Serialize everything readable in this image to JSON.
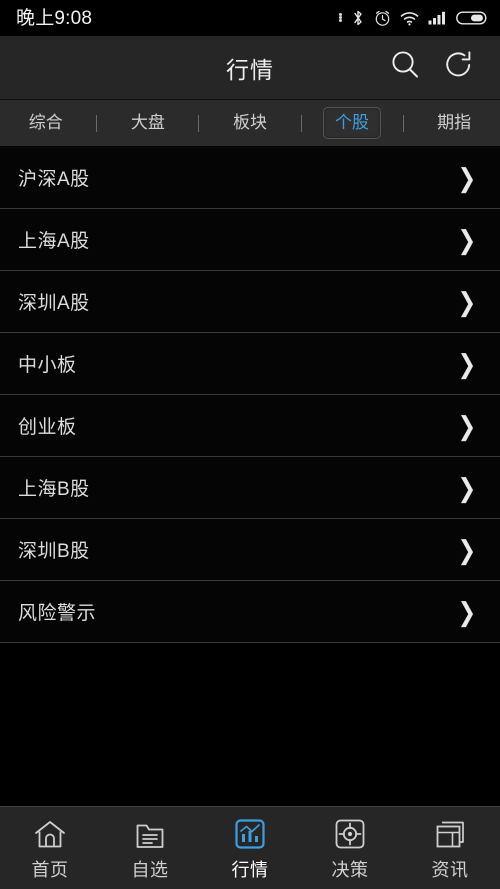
{
  "statusbar": {
    "time": "晚上9:08",
    "icons": [
      "more-dots",
      "bluetooth-icon",
      "alarm-icon",
      "wifi-icon",
      "signal-icon",
      "battery-icon"
    ]
  },
  "header": {
    "title": "行情",
    "search_label": "search-icon",
    "refresh_label": "refresh-icon"
  },
  "tabs": {
    "items": [
      {
        "label": "综合",
        "active": false
      },
      {
        "label": "大盘",
        "active": false
      },
      {
        "label": "板块",
        "active": false
      },
      {
        "label": "个股",
        "active": true
      },
      {
        "label": "期指",
        "active": false
      }
    ],
    "active_color": "#3d9ee0"
  },
  "list": {
    "chevron": "›",
    "items": [
      {
        "label": "沪深A股"
      },
      {
        "label": "上海A股"
      },
      {
        "label": "深圳A股"
      },
      {
        "label": "中小板"
      },
      {
        "label": "创业板"
      },
      {
        "label": "上海B股"
      },
      {
        "label": "深圳B股"
      },
      {
        "label": "风险警示"
      }
    ]
  },
  "bottomnav": {
    "items": [
      {
        "label": "首页",
        "icon": "home-icon",
        "active": false
      },
      {
        "label": "自选",
        "icon": "watchlist-icon",
        "active": false
      },
      {
        "label": "行情",
        "icon": "quotes-chart-icon",
        "active": true
      },
      {
        "label": "决策",
        "icon": "target-icon",
        "active": false
      },
      {
        "label": "资讯",
        "icon": "news-icon",
        "active": false
      }
    ],
    "active_color": "#3d9ee0"
  }
}
